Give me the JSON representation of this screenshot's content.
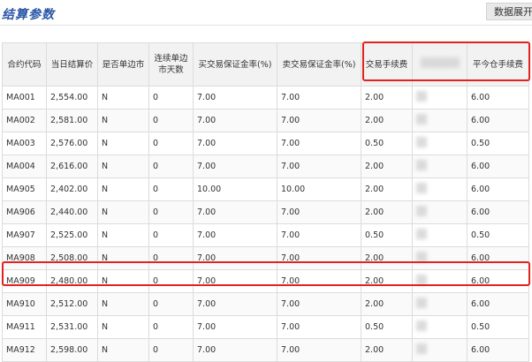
{
  "header": {
    "title": "结算参数",
    "button_label": "数据展开"
  },
  "table": {
    "columns": [
      "合约代码",
      "当日结算价",
      "是否单边市",
      "连续单边市天数",
      "买交易保证金率(%)",
      "卖交易保证金率(%)",
      "交易手续费",
      "",
      "平今仓手续费"
    ],
    "rows": [
      [
        "MA001",
        "2,554.00",
        "N",
        "0",
        "7.00",
        "7.00",
        "2.00",
        "",
        "6.00"
      ],
      [
        "MA002",
        "2,581.00",
        "N",
        "0",
        "7.00",
        "7.00",
        "2.00",
        "",
        "6.00"
      ],
      [
        "MA003",
        "2,576.00",
        "N",
        "0",
        "7.00",
        "7.00",
        "0.50",
        "",
        "0.50"
      ],
      [
        "MA004",
        "2,616.00",
        "N",
        "0",
        "7.00",
        "7.00",
        "2.00",
        "",
        "6.00"
      ],
      [
        "MA905",
        "2,402.00",
        "N",
        "0",
        "10.00",
        "10.00",
        "2.00",
        "",
        "6.00"
      ],
      [
        "MA906",
        "2,440.00",
        "N",
        "0",
        "7.00",
        "7.00",
        "2.00",
        "",
        "6.00"
      ],
      [
        "MA907",
        "2,525.00",
        "N",
        "0",
        "7.00",
        "7.00",
        "0.50",
        "",
        "0.50"
      ],
      [
        "MA908",
        "2,508.00",
        "N",
        "0",
        "7.00",
        "7.00",
        "2.00",
        "",
        "6.00"
      ],
      [
        "MA909",
        "2,480.00",
        "N",
        "0",
        "7.00",
        "7.00",
        "2.00",
        "",
        "6.00"
      ],
      [
        "MA910",
        "2,512.00",
        "N",
        "0",
        "7.00",
        "7.00",
        "2.00",
        "",
        "6.00"
      ],
      [
        "MA911",
        "2,531.00",
        "N",
        "0",
        "7.00",
        "7.00",
        "0.50",
        "",
        "0.50"
      ],
      [
        "MA912",
        "2,598.00",
        "N",
        "0",
        "7.00",
        "7.00",
        "2.00",
        "",
        "6.00"
      ]
    ]
  },
  "colors": {
    "title": "#2a56a8",
    "highlight": "#e0231e"
  }
}
